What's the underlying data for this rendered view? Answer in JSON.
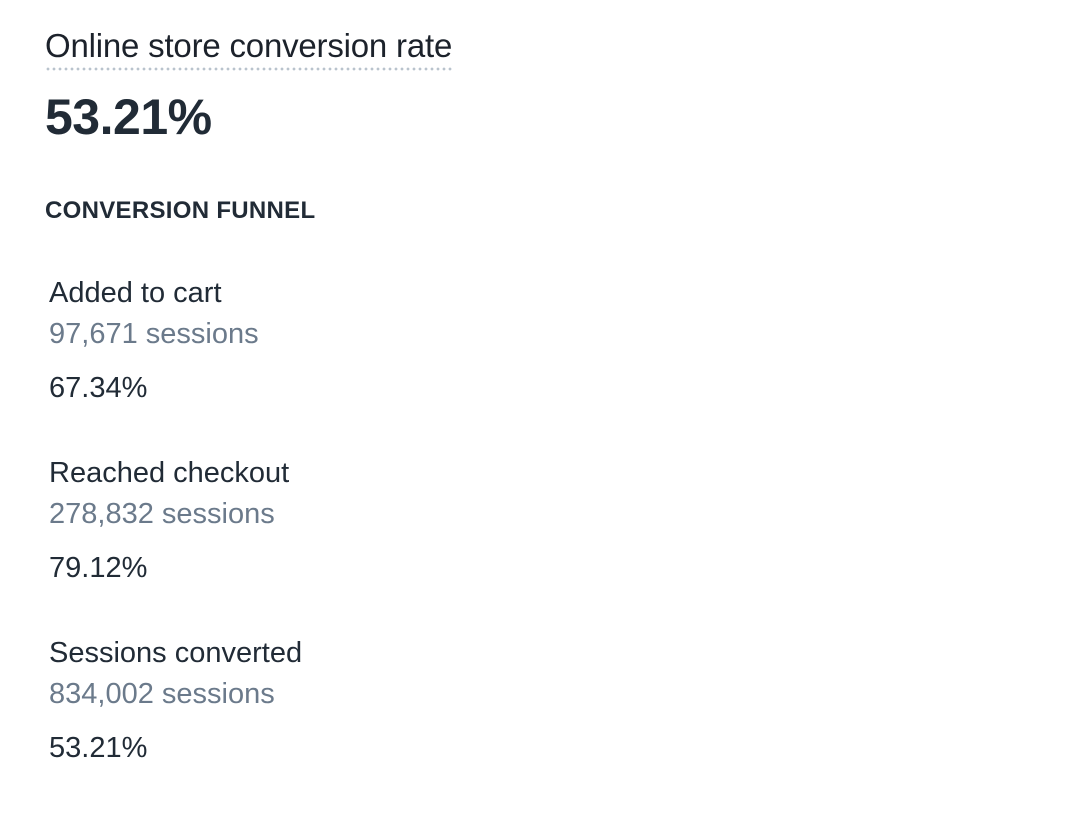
{
  "header": {
    "title": "Online store conversion rate",
    "value": "53.21%"
  },
  "funnel": {
    "heading": "CONVERSION FUNNEL",
    "steps": [
      {
        "label": "Added to cart",
        "sessions": "97,671 sessions",
        "rate": "67.34%"
      },
      {
        "label": "Reached checkout",
        "sessions": "278,832 sessions",
        "rate": "79.12%"
      },
      {
        "label": "Sessions converted",
        "sessions": "834,002 sessions",
        "rate": "53.21%"
      }
    ]
  },
  "colors": {
    "text_primary": "#212b36",
    "text_secondary": "#6b7a8b",
    "title_underline": "#b9c3cd",
    "background": "#ffffff"
  }
}
